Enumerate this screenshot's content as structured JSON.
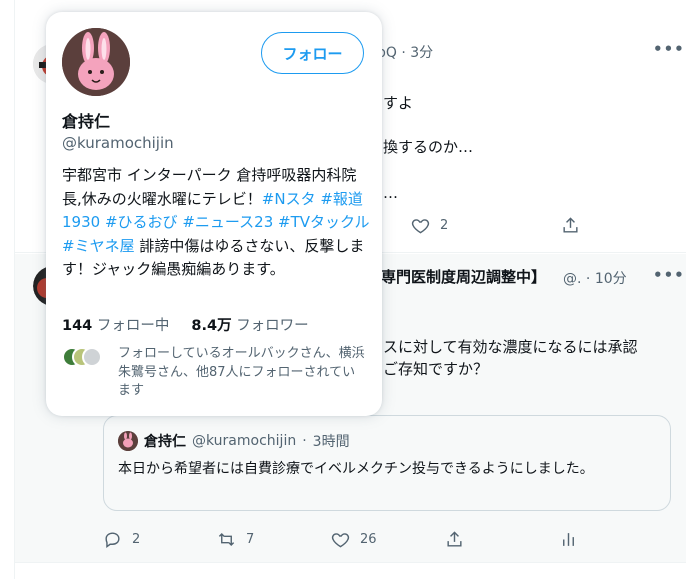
{
  "tweet1": {
    "handle_partial": "pQ",
    "time": "3分",
    "lines": [
      "すよ",
      "換するのか…",
      "…"
    ],
    "like_count": "2"
  },
  "tweet2": {
    "name_partial": "専門医制度周辺調整中】",
    "handle_partial": "@.",
    "time": "10分",
    "lines": [
      "スに対して有効な濃度になるには承認",
      "ご存知ですか？"
    ],
    "quote": {
      "name": "倉持仁",
      "handle": "@kuramochijin",
      "time": "3時間",
      "text": "本日から希望者には自費診療でイベルメクチン投与できるようにしました。"
    },
    "actions": {
      "reply": "2",
      "retweet": "7",
      "like": "26"
    }
  },
  "card": {
    "follow_label": "フォロー",
    "name": "倉持仁",
    "handle": "@kuramochijin",
    "bio": {
      "p1": "宇都宮市 インターパーク 倉持呼吸器内科院長,休みの火曜水曜にテレビ！",
      "t1": "#Nスタ",
      "t2": "#報道1930",
      "t3": "#ひるおび",
      "t4": "#ニュース23",
      "t5": "#TVタックル",
      "t6": "#ミヤネ屋",
      "p2": "誹謗中傷はゆるさない、反撃します！ジャック編愚痴編あります。"
    },
    "following_count": "144",
    "following_label": "フォロー中",
    "followers_count": "8.4万",
    "followers_label": "フォロワー",
    "mutuals_text": "フォローしているオールバックさん、横浜朱鷺号さん、他87人にフォローされています"
  },
  "colors": {
    "accent": "#1d9bf0",
    "secondary_text": "#536471",
    "border": "#cfd9de"
  }
}
